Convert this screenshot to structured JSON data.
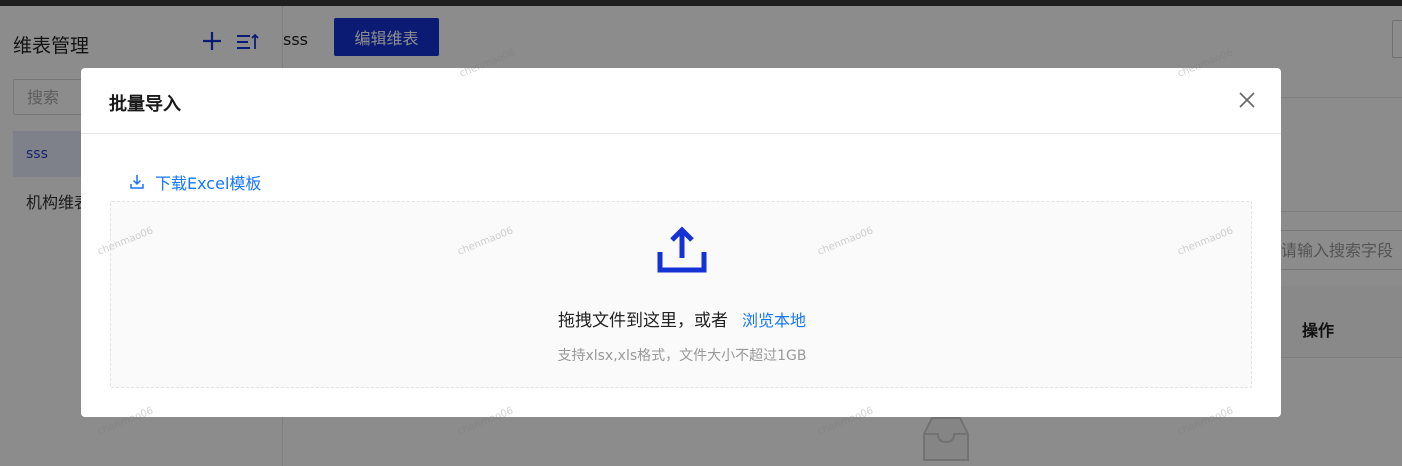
{
  "sidebar": {
    "title": "维表管理",
    "search_placeholder": "搜索",
    "items": [
      {
        "label": "sss",
        "active": true
      },
      {
        "label": "机构维表",
        "active": false
      }
    ]
  },
  "header": {
    "name": "sss",
    "edit_label": "编辑维表"
  },
  "table": {
    "search_placeholder": "请输入搜索字段",
    "ops_header": "操作"
  },
  "modal": {
    "title": "批量导入",
    "download_label": "下载Excel模板",
    "drop_text": "拖拽文件到这里，或者",
    "browse_label": "浏览本地",
    "hint": "支持xlsx,xls格式，文件大小不超过1GB"
  },
  "watermark": "chenmao06",
  "colors": {
    "primary": "#1532d4",
    "link": "#1677ff",
    "active_bg": "#e8ecfb"
  }
}
